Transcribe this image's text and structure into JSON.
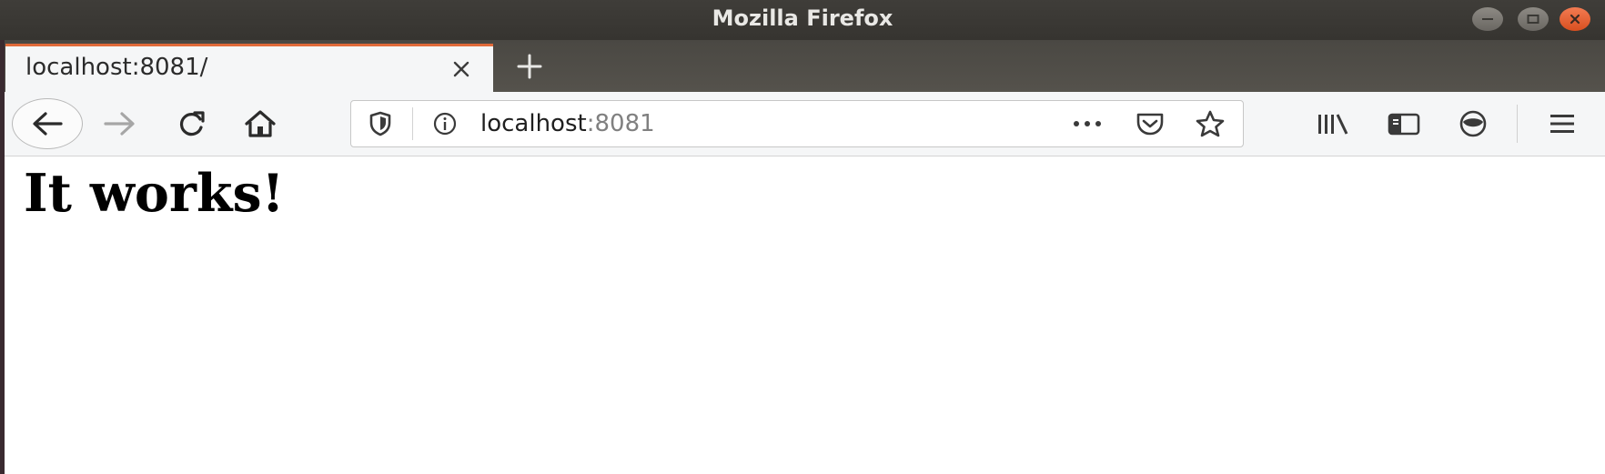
{
  "window": {
    "title": "Mozilla Firefox",
    "controls": [
      "minimize-icon",
      "maximize-icon",
      "close-icon"
    ]
  },
  "tabs": [
    {
      "label": "localhost:8081/",
      "active": true
    }
  ],
  "toolbar": {
    "buttons": [
      "back-arrow-icon",
      "forward-arrow-icon",
      "reload-icon",
      "home-icon"
    ],
    "right_buttons": [
      "library-icon",
      "sidebar-icon",
      "account-icon",
      "hamburger-menu-icon"
    ]
  },
  "urlbar": {
    "host": "localhost",
    "port": ":8081",
    "icons": [
      "tracking-shield-icon",
      "info-icon",
      "page-actions-icon",
      "pocket-icon",
      "bookmark-star-icon"
    ]
  },
  "page": {
    "heading": "It works!"
  },
  "colors": {
    "titlebar": "#3f3d39",
    "tab_strip": "#4f4c47",
    "active_tab_accent": "#e06a3a",
    "close_button": "#e2572a",
    "toolbar": "#f5f6f7"
  }
}
